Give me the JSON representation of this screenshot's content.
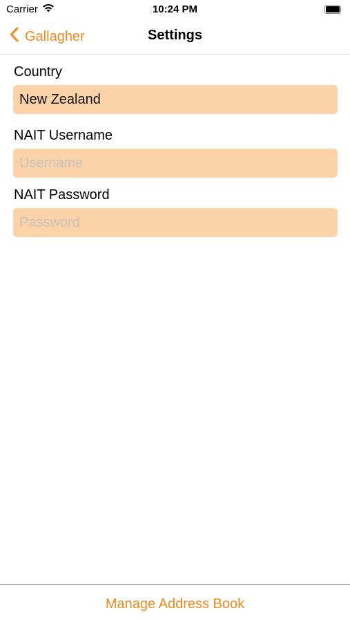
{
  "status_bar": {
    "carrier": "Carrier",
    "time": "10:24 PM",
    "wifi_icon": "wifi-icon",
    "battery_icon": "battery-icon"
  },
  "nav": {
    "back_label": "Gallagher",
    "back_icon": "chevron-left-icon",
    "title": "Settings"
  },
  "form": {
    "country": {
      "label": "Country",
      "value": "New Zealand"
    },
    "username": {
      "label": "NAIT Username",
      "value": "",
      "placeholder": "Username"
    },
    "password": {
      "label": "NAIT Password",
      "value": "",
      "placeholder": "Password"
    }
  },
  "footer": {
    "manage_label": "Manage Address Book"
  },
  "colors": {
    "accent": "#f08a1c",
    "field_background": "#fcd2a8"
  }
}
